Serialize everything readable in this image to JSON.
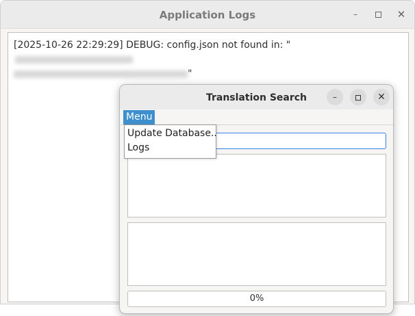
{
  "logs_window": {
    "title": "Application Logs",
    "controls": {
      "minimize": "–",
      "close": "✕"
    },
    "log_line_prefix": "[2025-10-26 22:29:29] DEBUG: config.json not found in: \"",
    "log_line_suffix": "\""
  },
  "search_window": {
    "title": "Translation Search",
    "controls": {
      "minimize": "–",
      "close": "✕"
    },
    "menu": {
      "label": "Menu",
      "items": [
        "Update Database..",
        "Logs"
      ]
    },
    "search_input": {
      "value": ""
    },
    "progress": {
      "value": 0,
      "label": "0%"
    }
  },
  "colors": {
    "accent": "#3584e4",
    "menu_highlight": "#3d8fce",
    "window_bg": "#f6f5f4"
  }
}
